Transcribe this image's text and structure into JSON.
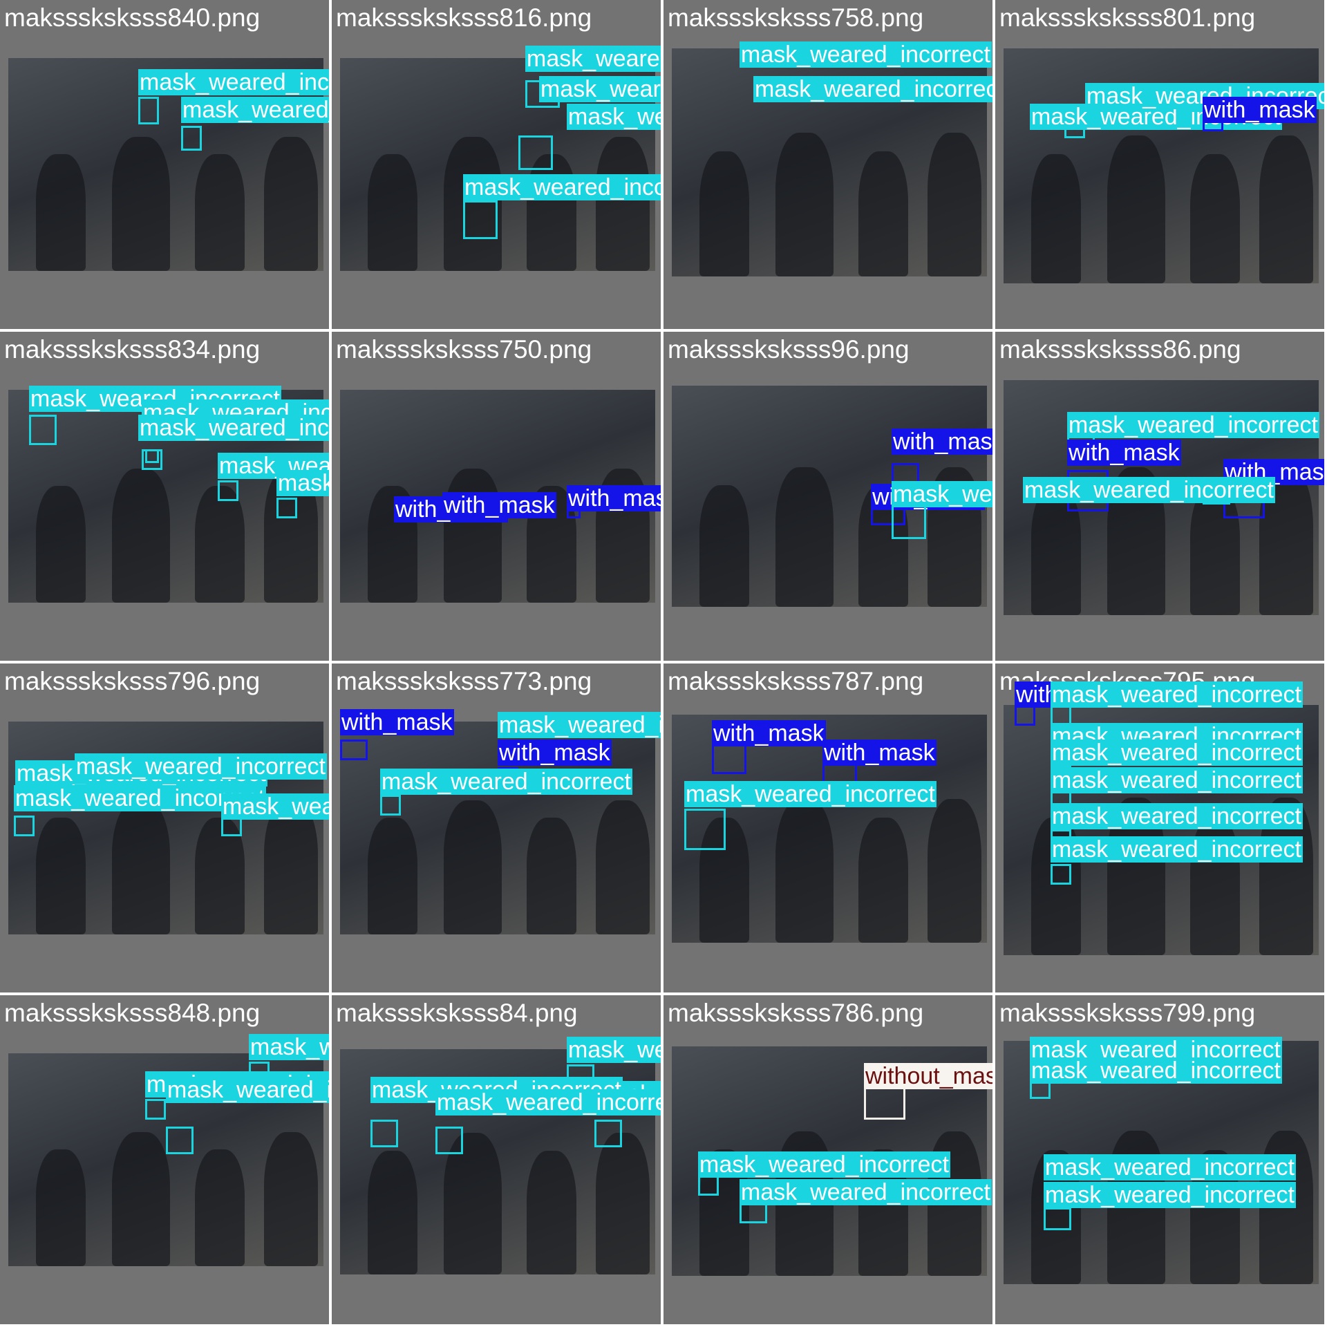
{
  "colors": {
    "mask_weared_incorrect": "#1ad4e0",
    "with_mask": "#1414e8",
    "without_mask": "#f7f4ef",
    "without_mask_text": "#6a1010",
    "tile_background": "#737373",
    "grid_background": "#ffffff"
  },
  "classes": [
    "mask_weared_incorrect",
    "with_mask",
    "without_mask"
  ],
  "tiles": [
    {
      "filename": "maksssksksss840.png",
      "labels": [
        "mask_weared_incorrect",
        "mask_weared_incorrect"
      ]
    },
    {
      "filename": "maksssksksss816.png",
      "labels": [
        "mask_weared_incorrect",
        "mask_weared_incorrect",
        "mask_weared_incorrect",
        "mask_weared_incorrect"
      ]
    },
    {
      "filename": "maksssksksss758.png",
      "labels": [
        "mask_weared_incorrect",
        "mask_weared_incorrect"
      ]
    },
    {
      "filename": "maksssksksss801.png",
      "labels": [
        "mask_weared_incorrect",
        "mask_weared_incorrect",
        "with_mask"
      ]
    },
    {
      "filename": "maksssksksss834.png",
      "labels": [
        "mask_weared_incorrect",
        "mask_weared_incorrect",
        "mask_weared_incorrect",
        "mask_weared_incorrect",
        "mask_weared_incorrect"
      ]
    },
    {
      "filename": "maksssksksss750.png",
      "labels": [
        "with_mask",
        "with_mask",
        "with_mask"
      ]
    },
    {
      "filename": "maksssksksss96.png",
      "labels": [
        "with_mask",
        "with_mask",
        "mask_weared_incorrect"
      ]
    },
    {
      "filename": "maksssksksss86.png",
      "labels": [
        "mask_weared_incorrect",
        "with_mask",
        "with_mask",
        "mask_weared_incorrect"
      ]
    },
    {
      "filename": "maksssksksss796.png",
      "labels": [
        "mask_weared_incorrect",
        "mask_weared_incorrect",
        "mask_weared_incorrect",
        "mask_weared_incorrect"
      ]
    },
    {
      "filename": "maksssksksss773.png",
      "labels": [
        "with_mask",
        "mask_weared_incorrect",
        "with_mask",
        "mask_weared_incorrect"
      ]
    },
    {
      "filename": "maksssksksss787.png",
      "labels": [
        "with_mask",
        "with_mask",
        "mask_weared_incorrect"
      ]
    },
    {
      "filename": "maksssksksss795.png",
      "labels": [
        "with_mask",
        "mask_weared_incorrect",
        "mask_weared_incorrect",
        "mask_weared_incorrect",
        "mask_weared_incorrect",
        "mask_weared_incorrect",
        "mask_weared_incorrect"
      ]
    },
    {
      "filename": "maksssksksss848.png",
      "labels": [
        "mask_weared_incorrect",
        "mask_weared_incorrect",
        "mask_weared_incorrect"
      ]
    },
    {
      "filename": "maksssksksss84.png",
      "labels": [
        "mask_weared_incorrect",
        "mask_weared_incorrect",
        "mask_weared_incorrect",
        "mask_weared_incorrect"
      ]
    },
    {
      "filename": "maksssksksss786.png",
      "labels": [
        "without_mask",
        "mask_weared_incorrect",
        "mask_weared_incorrect"
      ]
    },
    {
      "filename": "maksssksksss799.png",
      "labels": [
        "mask_weared_incorrect",
        "mask_weared_incorrect",
        "mask_weared_incorrect",
        "mask_weared_incorrect"
      ]
    }
  ]
}
